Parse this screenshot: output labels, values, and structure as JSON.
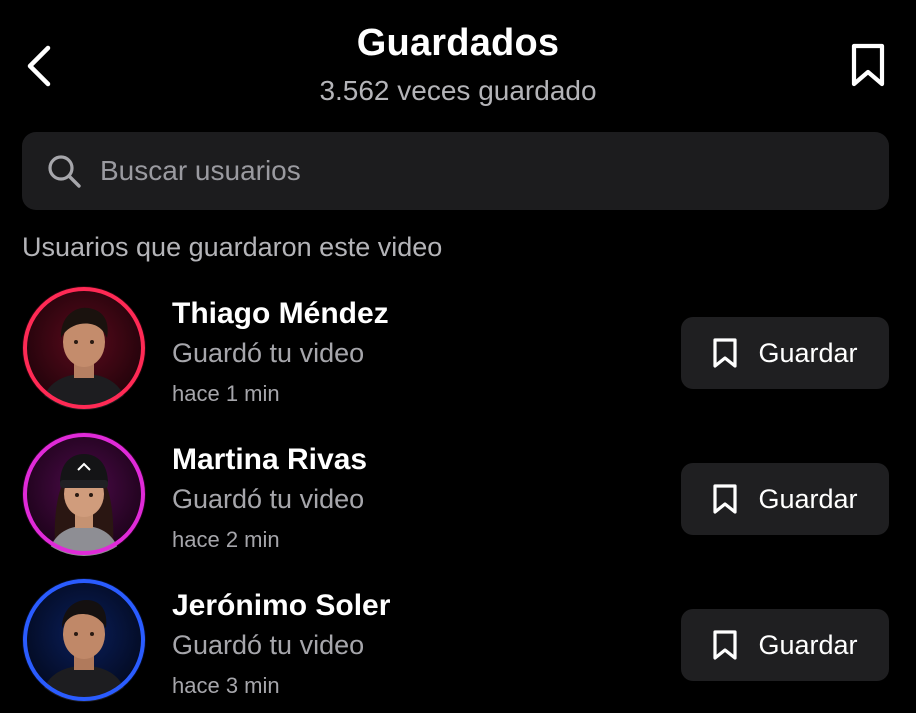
{
  "header": {
    "title": "Guardados",
    "subtitle": "3.562 veces guardado",
    "back_icon": "chevron-left-icon",
    "bookmark_icon": "bookmark-icon"
  },
  "search": {
    "placeholder": "Buscar usuarios",
    "value": "",
    "icon": "search-icon"
  },
  "section": {
    "label": "Usuarios que guardaron este video"
  },
  "users": [
    {
      "name": "Thiago Méndez",
      "action": "Guardó tu video",
      "time": "hace 1 min",
      "button_label": "Guardar",
      "ring_color": "#ff2a55"
    },
    {
      "name": "Martina Rivas",
      "action": "Guardó tu video",
      "time": "hace 2 min",
      "button_label": "Guardar",
      "ring_color": "#e02ad8"
    },
    {
      "name": "Jerónimo Soler",
      "action": "Guardó tu video",
      "time": "hace 3 min",
      "button_label": "Guardar",
      "ring_color": "#2a5cff"
    }
  ],
  "colors": {
    "background": "#000000",
    "surface": "#1c1c1e",
    "text_primary": "#ffffff",
    "text_secondary": "#a6a6ab"
  }
}
